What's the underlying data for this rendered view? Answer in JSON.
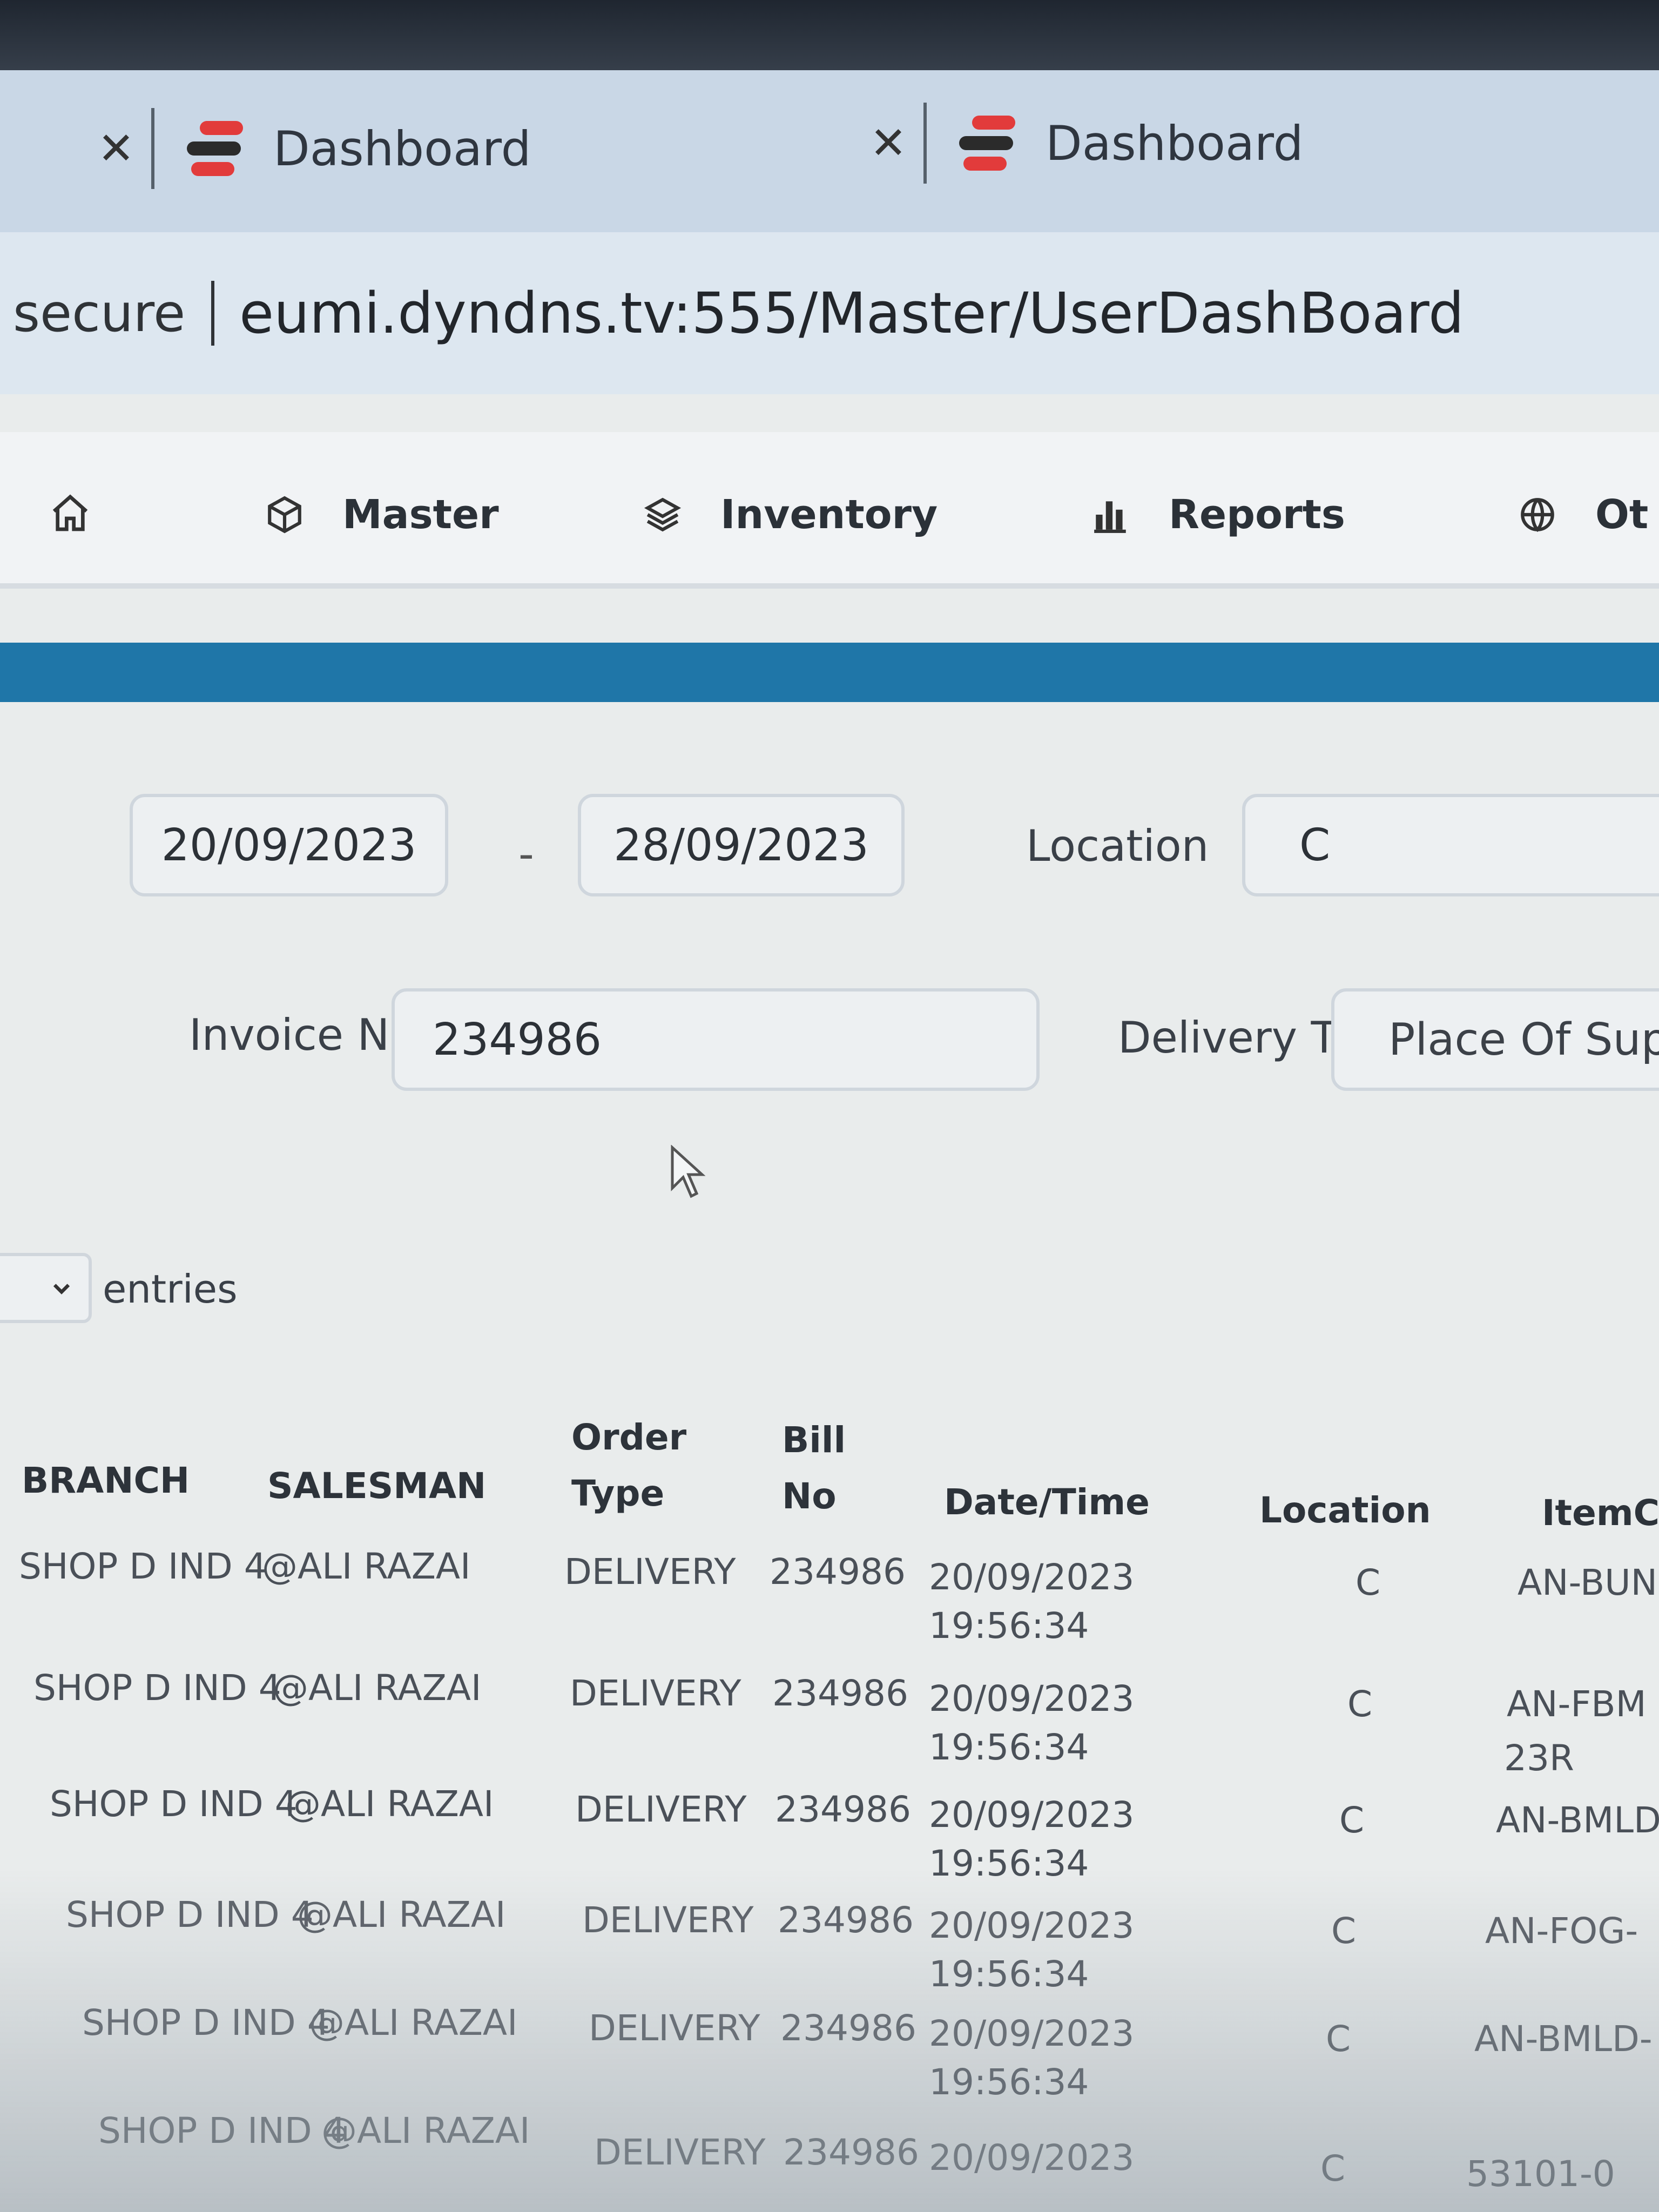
{
  "browser": {
    "tabs": [
      {
        "title": "Dashboard"
      },
      {
        "title": "Dashboard"
      }
    ],
    "address": {
      "security": "secure",
      "url": "eumi.dyndns.tv:555/Master/UserDashBoard"
    }
  },
  "nav": {
    "items": [
      {
        "label": "Master",
        "icon": "cube-icon"
      },
      {
        "label": "Inventory",
        "icon": "layers-icon"
      },
      {
        "label": "Reports",
        "icon": "bar-chart-icon"
      },
      {
        "label": "Ot",
        "icon": "globe-icon"
      }
    ]
  },
  "filters": {
    "date_from": "20/09/2023",
    "date_separator": "-",
    "date_to": "28/09/2023",
    "location_label": "Location",
    "location_value": "C",
    "invoice_label": "Invoice No",
    "invoice_value": "234986",
    "delivery_label": "Delivery Ty",
    "delivery_value": "Place Of Supp"
  },
  "entries": {
    "label": "entries"
  },
  "table": {
    "headers": {
      "branch": "BRANCH",
      "salesman": "SALESMAN",
      "order_type_1": "Order",
      "order_type_2": "Type",
      "bill_no_1": "Bill",
      "bill_no_2": "No",
      "datetime": "Date/Time",
      "location": "Location",
      "item": "ItemC"
    },
    "rows": [
      {
        "branch": "SHOP D IND 4",
        "salesman": "@ALI RAZAI",
        "order_type": "DELIVERY",
        "bill_no": "234986",
        "date": "20/09/2023",
        "time": "19:56:34",
        "location": "C",
        "item": "AN-BUN",
        "item2": ""
      },
      {
        "branch": "SHOP D IND 4",
        "salesman": "@ALI RAZAI",
        "order_type": "DELIVERY",
        "bill_no": "234986",
        "date": "20/09/2023",
        "time": "19:56:34",
        "location": "C",
        "item": "AN-FBM",
        "item2": "23R"
      },
      {
        "branch": "SHOP D IND 4",
        "salesman": "@ALI RAZAI",
        "order_type": "DELIVERY",
        "bill_no": "234986",
        "date": "20/09/2023",
        "time": "19:56:34",
        "location": "C",
        "item": "AN-BMLD",
        "item2": ""
      },
      {
        "branch": "SHOP D IND 4",
        "salesman": "@ALI RAZAI",
        "order_type": "DELIVERY",
        "bill_no": "234986",
        "date": "20/09/2023",
        "time": "19:56:34",
        "location": "C",
        "item": "AN-FOG-",
        "item2": ""
      },
      {
        "branch": "SHOP D IND 4",
        "salesman": "@ALI RAZAI",
        "order_type": "DELIVERY",
        "bill_no": "234986",
        "date": "20/09/2023",
        "time": "19:56:34",
        "location": "C",
        "item": "AN-BMLD-",
        "item2": ""
      },
      {
        "branch": "SHOP D IND 4",
        "salesman": "@ALI RAZAI",
        "order_type": "DELIVERY",
        "bill_no": "234986",
        "date": "20/09/2023",
        "time": "",
        "location": "C",
        "item": "53101-0",
        "item2": ""
      }
    ]
  },
  "colors": {
    "accent_banner": "#1f76a8",
    "logo_red": "#e23b3b"
  }
}
